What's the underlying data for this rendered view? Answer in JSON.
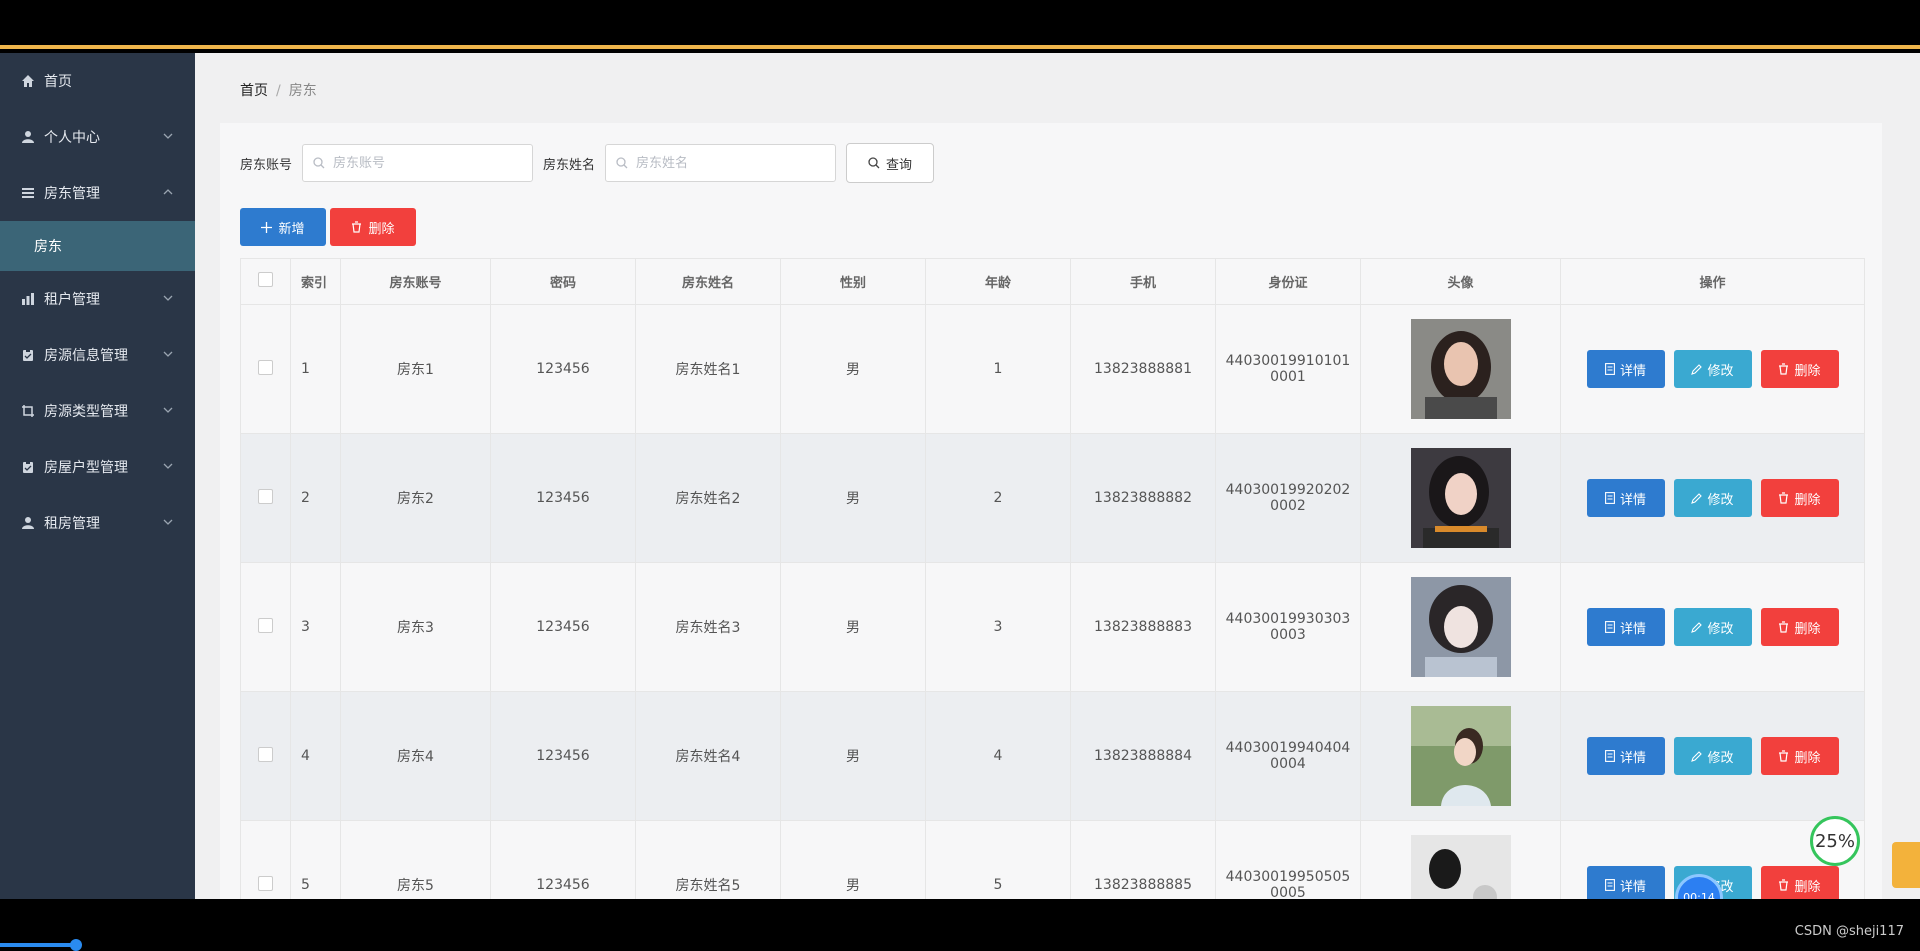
{
  "sidebar": {
    "items": [
      {
        "label": "首页",
        "icon": "home-icon",
        "chevron": false
      },
      {
        "label": "个人中心",
        "icon": "user-icon",
        "chevron": "down"
      },
      {
        "label": "房东管理",
        "icon": "list-icon",
        "chevron": "up"
      },
      {
        "label": "租户管理",
        "icon": "chart-icon",
        "chevron": "down"
      },
      {
        "label": "房源信息管理",
        "icon": "clipboard-icon",
        "chevron": "down"
      },
      {
        "label": "房源类型管理",
        "icon": "crop-icon",
        "chevron": "down"
      },
      {
        "label": "房屋户型管理",
        "icon": "clipboard-icon",
        "chevron": "down"
      },
      {
        "label": "租房管理",
        "icon": "user-icon",
        "chevron": "down"
      }
    ],
    "active_sub": "房东"
  },
  "breadcrumb": {
    "home": "首页",
    "separator": "/",
    "current": "房东"
  },
  "search": {
    "account_label": "房东账号",
    "account_placeholder": "房东账号",
    "name_label": "房东姓名",
    "name_placeholder": "房东姓名",
    "query_button": "查询"
  },
  "actions": {
    "add": "新增",
    "delete": "删除"
  },
  "table": {
    "headers": [
      "索引",
      "房东账号",
      "密码",
      "房东姓名",
      "性别",
      "年龄",
      "手机",
      "身份证",
      "头像",
      "操作"
    ],
    "rows": [
      {
        "index": "1",
        "account": "房东1",
        "password": "123456",
        "name": "房东姓名1",
        "gender": "男",
        "age": "1",
        "phone": "13823888881",
        "id_line1": "44030019910101",
        "id_line2": "0001"
      },
      {
        "index": "2",
        "account": "房东2",
        "password": "123456",
        "name": "房东姓名2",
        "gender": "男",
        "age": "2",
        "phone": "13823888882",
        "id_line1": "44030019920202",
        "id_line2": "0002"
      },
      {
        "index": "3",
        "account": "房东3",
        "password": "123456",
        "name": "房东姓名3",
        "gender": "男",
        "age": "3",
        "phone": "13823888883",
        "id_line1": "44030019930303",
        "id_line2": "0003"
      },
      {
        "index": "4",
        "account": "房东4",
        "password": "123456",
        "name": "房东姓名4",
        "gender": "男",
        "age": "4",
        "phone": "13823888884",
        "id_line1": "44030019940404",
        "id_line2": "0004"
      },
      {
        "index": "5",
        "account": "房东5",
        "password": "123456",
        "name": "房东姓名5",
        "gender": "男",
        "age": "5",
        "phone": "13823888885",
        "id_line1": "44030019950505",
        "id_line2": "0005"
      }
    ],
    "row_actions": {
      "detail": "详情",
      "edit": "修改",
      "delete": "删除"
    }
  },
  "overlay": {
    "watermark": "CSDN @sheji117",
    "percent": "25%",
    "timer": "00:14"
  },
  "colors": {
    "sidebar_bg": "#2a3647",
    "sidebar_active": "#3b6577",
    "primary": "#2e7bcf",
    "info": "#3aa9d1",
    "danger": "#f2403d",
    "top_accent": "#f0b64c"
  }
}
